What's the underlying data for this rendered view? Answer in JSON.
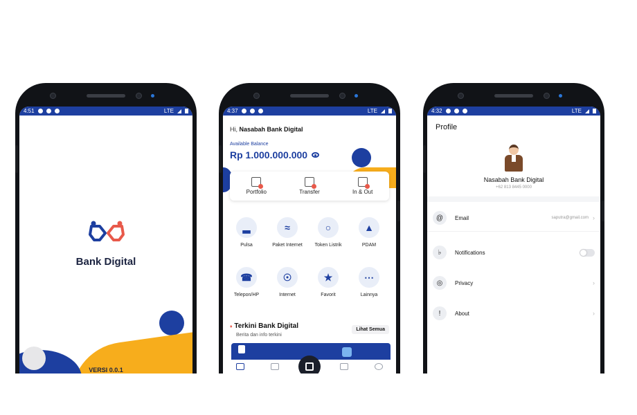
{
  "colors": {
    "primary": "#1d3fa0",
    "accent": "#f7ad1c"
  },
  "splash": {
    "status_time": "4:51",
    "network": "LTE",
    "app_name": "Bank Digital",
    "version": "VERSI 0.0.1"
  },
  "home": {
    "status_time": "4:37",
    "network": "LTE",
    "greeting_prefix": "Hi,",
    "user_name": "Nasabah Bank Digital",
    "available_label": "Available Balance",
    "balance": "Rp 1.000.000.000",
    "quick_actions": [
      "Portfolio",
      "Transfer",
      "In & Out"
    ],
    "services": [
      "Pulsa",
      "Paket Internet",
      "Token Listrik",
      "PDAM",
      "Telepon/HP",
      "Internet",
      "Favorit",
      "Lainnya"
    ],
    "news_title": "Terkini Bank Digital",
    "news_subtitle": "Berita dan info terkini",
    "see_all": "Lihat Semua"
  },
  "profile": {
    "status_time": "4:32",
    "network": "LTE",
    "title": "Profile",
    "name": "Nasabah Bank Digital",
    "phone": "+62 813 8445 0000",
    "menu": [
      {
        "label": "Email",
        "value": "saputra@gmail.com"
      },
      {
        "label": "Notifications"
      },
      {
        "label": "Privacy"
      },
      {
        "label": "About"
      }
    ]
  }
}
